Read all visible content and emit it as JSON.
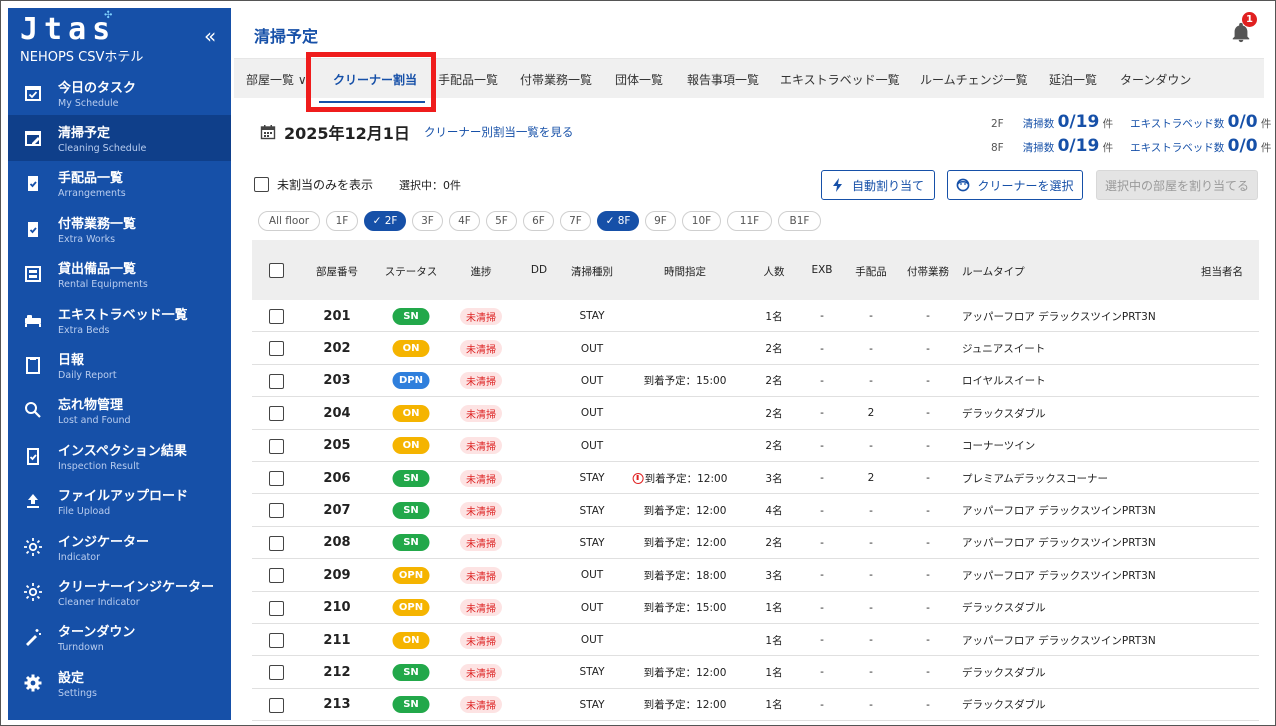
{
  "sidebar": {
    "brand": "Jtas",
    "hotel": "NEHOPS CSVホテル",
    "collapse": "«",
    "items": [
      {
        "label": "今日のタスク",
        "sub": "My Schedule",
        "icon": "calendar-check-icon"
      },
      {
        "label": "清掃予定",
        "sub": "Cleaning Schedule",
        "icon": "calendar-edit-icon",
        "active": true
      },
      {
        "label": "手配品一覧",
        "sub": "Arrangements",
        "icon": "clipboard-check-icon"
      },
      {
        "label": "付帯業務一覧",
        "sub": "Extra Works",
        "icon": "clipboard-check-icon"
      },
      {
        "label": "貸出備品一覧",
        "sub": "Rental Equipments",
        "icon": "rental-icon"
      },
      {
        "label": "エキストラベッド一覧",
        "sub": "Extra Beds",
        "icon": "bed-icon"
      },
      {
        "label": "日報",
        "sub": "Daily Report",
        "icon": "report-icon"
      },
      {
        "label": "忘れ物管理",
        "sub": "Lost and Found",
        "icon": "search-icon"
      },
      {
        "label": "インスペクション結果",
        "sub": "Inspection Result",
        "icon": "inspection-icon"
      },
      {
        "label": "ファイルアップロード",
        "sub": "File Upload",
        "icon": "upload-icon"
      },
      {
        "label": "インジケーター",
        "sub": "Indicator",
        "icon": "sun-icon"
      },
      {
        "label": "クリーナーインジケーター",
        "sub": "Cleaner Indicator",
        "icon": "sun-icon"
      },
      {
        "label": "ターンダウン",
        "sub": "Turndown",
        "icon": "magic-wand-icon"
      },
      {
        "label": "設定",
        "sub": "Settings",
        "icon": "gear-icon"
      }
    ]
  },
  "header": {
    "title": "清掃予定",
    "notifications": "1"
  },
  "tabs": [
    {
      "label": "部屋一覧 ∨"
    },
    {
      "label": "クリーナー割当",
      "active": true
    },
    {
      "label": "手配品一覧"
    },
    {
      "label": "付帯業務一覧"
    },
    {
      "label": "団体一覧"
    },
    {
      "label": "報告事項一覧"
    },
    {
      "label": "エキストラベッド一覧"
    },
    {
      "label": "ルームチェンジ一覧"
    },
    {
      "label": "延泊一覧"
    },
    {
      "label": "ターンダウン"
    }
  ],
  "date": {
    "value": "2025年12月1日",
    "link": "クリーナー別割当一覧を見る"
  },
  "stats": [
    {
      "floor": "2F",
      "clean_label": "清掃数",
      "clean": "0/19",
      "clean_unit": "件",
      "bed_label": "エキストラベッド数",
      "bed": "0/0",
      "bed_unit": "件"
    },
    {
      "floor": "8F",
      "clean_label": "清掃数",
      "clean": "0/19",
      "clean_unit": "件",
      "bed_label": "エキストラベッド数",
      "bed": "0/0",
      "bed_unit": "件"
    }
  ],
  "filter": {
    "unassigned_label": "未割当のみを表示",
    "selected": "選択中：0件"
  },
  "buttons": {
    "auto": "自動割り当て",
    "choose": "クリーナーを選択",
    "assign": "選択中の部屋を割り当てる"
  },
  "floors": [
    {
      "label": "All floor"
    },
    {
      "label": "1F"
    },
    {
      "label": "✓ 2F",
      "on": true
    },
    {
      "label": "3F"
    },
    {
      "label": "4F"
    },
    {
      "label": "5F"
    },
    {
      "label": "6F"
    },
    {
      "label": "7F"
    },
    {
      "label": "✓ 8F",
      "on": true
    },
    {
      "label": "9F"
    },
    {
      "label": "10F"
    },
    {
      "label": "11F"
    },
    {
      "label": "B1F"
    }
  ],
  "columns": [
    "部屋番号",
    "ステータス",
    "進捗",
    "DD",
    "清掃種別",
    "時間指定",
    "人数",
    "EXB",
    "手配品",
    "付帯業務",
    "ルームタイプ",
    "担当者名"
  ],
  "colors": {
    "SN": "#22a84a",
    "ON": "#f5b400",
    "DPN": "#2f7fdc",
    "OPN": "#f5b400"
  },
  "rows": [
    {
      "room": "201",
      "status": "SN",
      "progress": "未清掃",
      "dd": "",
      "type": "STAY",
      "time": "",
      "people": "1名",
      "exb": "-",
      "arr": "-",
      "extra": "-",
      "roomtype": "アッパーフロア デラックスツインPRT3N",
      "staff": ""
    },
    {
      "room": "202",
      "status": "ON",
      "progress": "未清掃",
      "dd": "",
      "type": "OUT",
      "time": "",
      "people": "2名",
      "exb": "-",
      "arr": "-",
      "extra": "-",
      "roomtype": "ジュニアスイート",
      "staff": ""
    },
    {
      "room": "203",
      "status": "DPN",
      "progress": "未清掃",
      "dd": "",
      "type": "OUT",
      "time": "到着予定：15:00",
      "people": "2名",
      "exb": "-",
      "arr": "-",
      "extra": "-",
      "roomtype": "ロイヤルスイート",
      "staff": ""
    },
    {
      "room": "204",
      "status": "ON",
      "progress": "未清掃",
      "dd": "",
      "type": "OUT",
      "time": "",
      "people": "2名",
      "exb": "-",
      "arr": "2",
      "extra": "-",
      "roomtype": "デラックスダブル",
      "staff": ""
    },
    {
      "room": "205",
      "status": "ON",
      "progress": "未清掃",
      "dd": "",
      "type": "OUT",
      "time": "",
      "people": "2名",
      "exb": "-",
      "arr": "-",
      "extra": "-",
      "roomtype": "コーナーツイン",
      "staff": ""
    },
    {
      "room": "206",
      "status": "SN",
      "progress": "未清掃",
      "dd": "",
      "type": "STAY",
      "time": "到着予定：12:00",
      "warn": true,
      "people": "3名",
      "exb": "-",
      "arr": "2",
      "extra": "-",
      "roomtype": "プレミアムデラックスコーナー",
      "staff": ""
    },
    {
      "room": "207",
      "status": "SN",
      "progress": "未清掃",
      "dd": "",
      "type": "STAY",
      "time": "到着予定：12:00",
      "people": "4名",
      "exb": "-",
      "arr": "-",
      "extra": "-",
      "roomtype": "アッパーフロア デラックスツインPRT3N",
      "staff": ""
    },
    {
      "room": "208",
      "status": "SN",
      "progress": "未清掃",
      "dd": "",
      "type": "STAY",
      "time": "到着予定：12:00",
      "people": "2名",
      "exb": "-",
      "arr": "-",
      "extra": "-",
      "roomtype": "アッパーフロア デラックスツインPRT3N",
      "staff": ""
    },
    {
      "room": "209",
      "status": "OPN",
      "progress": "未清掃",
      "dd": "",
      "type": "OUT",
      "time": "到着予定：18:00",
      "people": "3名",
      "exb": "-",
      "arr": "-",
      "extra": "-",
      "roomtype": "アッパーフロア デラックスツインPRT3N",
      "staff": ""
    },
    {
      "room": "210",
      "status": "OPN",
      "progress": "未清掃",
      "dd": "",
      "type": "OUT",
      "time": "到着予定：15:00",
      "people": "1名",
      "exb": "-",
      "arr": "-",
      "extra": "-",
      "roomtype": "デラックスダブル",
      "staff": ""
    },
    {
      "room": "211",
      "status": "ON",
      "progress": "未清掃",
      "dd": "",
      "type": "OUT",
      "time": "",
      "people": "1名",
      "exb": "-",
      "arr": "-",
      "extra": "-",
      "roomtype": "アッパーフロア デラックスツインPRT3N",
      "staff": ""
    },
    {
      "room": "212",
      "status": "SN",
      "progress": "未清掃",
      "dd": "",
      "type": "STAY",
      "time": "到着予定：12:00",
      "people": "1名",
      "exb": "-",
      "arr": "-",
      "extra": "-",
      "roomtype": "デラックスダブル",
      "staff": ""
    },
    {
      "room": "213",
      "status": "SN",
      "progress": "未清掃",
      "dd": "",
      "type": "STAY",
      "time": "到着予定：12:00",
      "people": "1名",
      "exb": "-",
      "arr": "-",
      "extra": "-",
      "roomtype": "デラックスダブル",
      "staff": ""
    }
  ]
}
